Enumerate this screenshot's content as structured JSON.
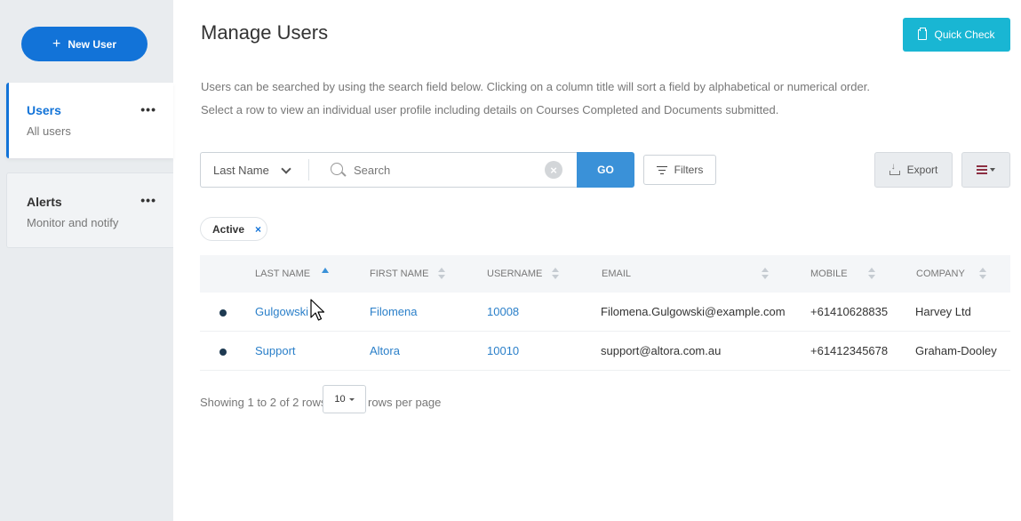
{
  "sidebar": {
    "new_user_label": "New User",
    "items": [
      {
        "title": "Users",
        "subtitle": "All users",
        "more": "•••",
        "active": true
      },
      {
        "title": "Alerts",
        "subtitle": "Monitor and notify",
        "more": "•••",
        "active": false
      }
    ]
  },
  "header": {
    "title": "Manage Users",
    "quick_check_label": "Quick Check",
    "description_line1": "Users can be searched by using the search field below. Clicking on a column title will sort a field by alphabetical or numerical order.",
    "description_line2": "Select a row to view an individual user profile including details on Courses Completed and Documents submitted."
  },
  "search": {
    "field_value": "Last Name",
    "placeholder": "Search",
    "clear_symbol": "×",
    "go_label": "GO",
    "filters_label": "Filters",
    "export_label": "Export"
  },
  "active_filter": {
    "label": "Active",
    "remove_symbol": "×"
  },
  "table": {
    "columns": [
      "LAST NAME",
      "FIRST NAME",
      "USERNAME",
      "EMAIL",
      "MOBILE",
      "COMPANY"
    ],
    "sorted_column": "LAST NAME",
    "sort_direction": "ascending",
    "rows": [
      {
        "last_name": "Gulgowski",
        "first_name": "Filomena",
        "username": "10008",
        "email": "Filomena.Gulgowski@example.com",
        "mobile": "+61410628835",
        "company": "Harvey Ltd"
      },
      {
        "last_name": "Support",
        "first_name": "Altora",
        "username": "10010",
        "email": "support@altora.com.au",
        "mobile": "+61412345678",
        "company": "Graham-Dooley"
      }
    ]
  },
  "pagination": {
    "showing_text": "Showing 1 to 2 of 2 rows",
    "per_page_value": "10",
    "per_page_suffix": "rows per page"
  },
  "colors": {
    "primary": "#1273d8",
    "quick_check": "#19b6d3",
    "go": "#3a91d8",
    "link": "#2a7fc9",
    "sidebar_bg": "#e9ecef"
  }
}
